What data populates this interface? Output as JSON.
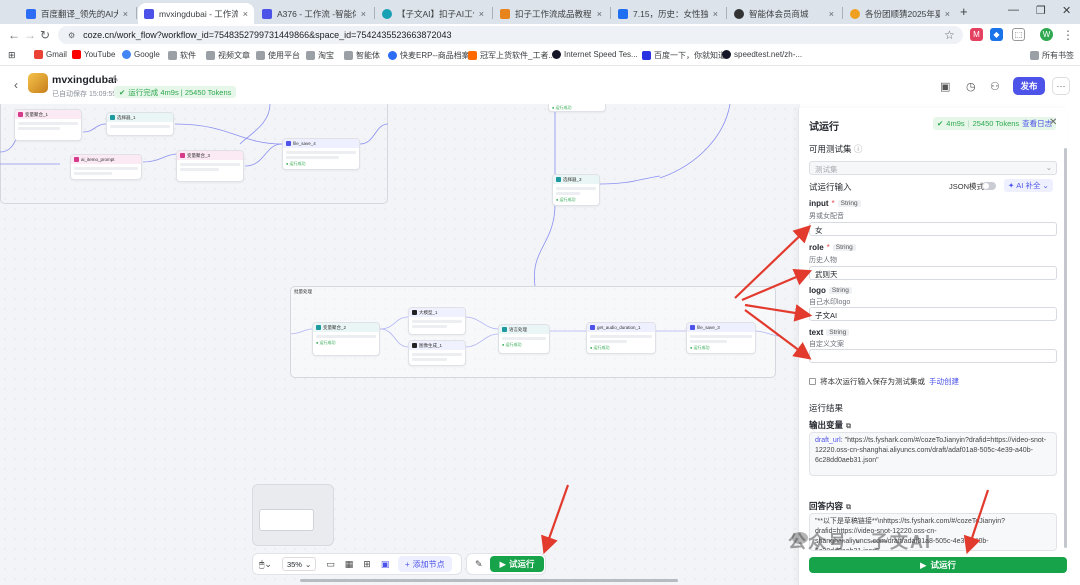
{
  "browser": {
    "tabs": [
      {
        "label": "百度翻译_领先的AI大模型翻译",
        "color": "#2d6df6"
      },
      {
        "label": "mvxingdubai - 工作流 - 扣",
        "color": "#4d53e8",
        "active": true
      },
      {
        "label": "A376 - 工作流 -智能体平",
        "color": "#4d53e8"
      },
      {
        "label": "【子文AI】扣子AI工作流",
        "color": "#18a0b5"
      },
      {
        "label": "扣子工作流成品教程 - 飞",
        "color": "#e8841c"
      },
      {
        "label": "7.15，历史：女性独白历",
        "color": "#1f6ff2"
      },
      {
        "label": "智能体会员商城",
        "color": "#333333"
      },
      {
        "label": "各份团顺猜2025年夏年",
        "color": "#f0a020"
      }
    ],
    "url": "coze.cn/work_flow?workflow_id=7548352799731449866&space_id=7542435523663872043",
    "bookmarks": [
      "Gmail",
      "YouTube",
      "Google",
      "软件",
      "视频文章",
      "使用平台",
      "淘宝",
      "智能体",
      "快麦ERP--商品档案",
      "冠军上货软件_工者...",
      "Internet Speed Tes...",
      "百度一下，你就知道",
      "speedtest.net/zh-..."
    ],
    "all_bookmarks": "所有书签"
  },
  "header": {
    "name": "mvxingdubai",
    "saved": "已自动保存 15:09:55",
    "run_status": "运行完成 4m9s | 25450 Tokens",
    "publish": "发布"
  },
  "canvas": {
    "zoom": "35%",
    "add_node": "添加节点",
    "run": "试运行",
    "batch_label": "批量处理",
    "nodes": {
      "n1": "变量聚合_1",
      "n2": "选择器_1",
      "n3": "ai_itemo_prompt",
      "n4": "变量聚合_3",
      "n5": "file_save_4",
      "n6": "插件节点",
      "n7": "变量聚合_2",
      "n8": "选择器_3",
      "n9": "大模型_1",
      "n10": "语言处理",
      "n11": "图像生成_1",
      "n12": "get_audio_duration_1",
      "n13": "file_save_3"
    }
  },
  "panel": {
    "title": "试运行",
    "badge_time": "4m9s",
    "badge_tokens": "25450 Tokens",
    "badge_log": "查看日志",
    "testset_label": "可用测试集",
    "testset_placeholder": "测试集",
    "input_label": "试运行输入",
    "json_mode": "JSON模式",
    "ai_fill": "AI 补全",
    "fields": [
      {
        "name": "input",
        "type": "String",
        "desc": "男或女配音",
        "value": "女"
      },
      {
        "name": "role",
        "type": "String",
        "desc": "历史人物",
        "value": "武则天"
      },
      {
        "name": "logo",
        "type": "String",
        "desc": "自己水印logo",
        "value": "子文AI"
      },
      {
        "name": "text",
        "type": "String",
        "desc": "自定义文案",
        "value": ""
      }
    ],
    "save_testset": "将本次运行输入保存为测试集或",
    "manual_create": "手动创建",
    "result_label": "运行结果",
    "output_var_label": "输出变量",
    "output_key": "draft_url",
    "output_value": "\"https://ts.fyshark.com/#/cozeToJianyin?drafid=https://video-snot-12220.oss-cn-shanghai.aliyuncs.com/draft/adaf01a8-505c-4e39-a40b-6c28dd0aeb31.json\"",
    "answer_label": "回答内容",
    "answer_value": "\"**以下是草稿链接**\\nhttps://ts.fyshark.com/#/cozeToJianyin?drafid=https://video-snot-12220.oss-cn-shanghai.aliyuncs.com/draft/adaf01a8-505c-4e39-a40b-6c28dd0aeb31.json\"",
    "run_button": "试运行"
  },
  "watermark": "公众号 · 子文AI",
  "colors": {
    "accent": "#4d53e8",
    "success": "#17a34a",
    "arrow": "#e23b2e"
  }
}
